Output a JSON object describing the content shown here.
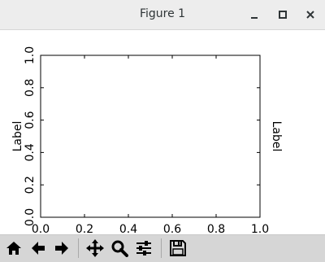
{
  "window": {
    "title": "Figure 1",
    "controls": {
      "minimize": "minimize-icon",
      "maximize": "maximize-icon",
      "close": "close-icon"
    }
  },
  "toolbar": {
    "buttons": [
      {
        "name": "home",
        "icon": "home-icon"
      },
      {
        "name": "back",
        "icon": "arrow-left-icon"
      },
      {
        "name": "forward",
        "icon": "arrow-right-icon"
      },
      {
        "name": "pan",
        "icon": "move-icon"
      },
      {
        "name": "zoom",
        "icon": "magnifier-icon"
      },
      {
        "name": "configure-subplots",
        "icon": "sliders-icon"
      },
      {
        "name": "save",
        "icon": "floppy-disk-icon"
      }
    ]
  },
  "chart_data": {
    "type": "line",
    "title": "",
    "xlabel": "",
    "ylabel": "Label",
    "y2label": "Label",
    "xlim": [
      0.0,
      1.0
    ],
    "ylim": [
      0.0,
      1.0
    ],
    "xticks": [
      "0.0",
      "0.2",
      "0.4",
      "0.6",
      "0.8",
      "1.0"
    ],
    "yticks": [
      "0.0",
      "0.2",
      "0.4",
      "0.6",
      "0.8",
      "1.0"
    ],
    "grid": false,
    "series": []
  }
}
